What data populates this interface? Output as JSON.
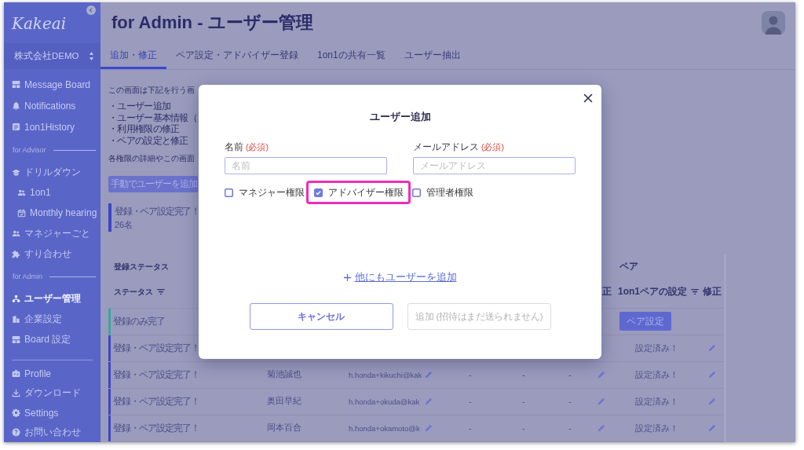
{
  "sidebar": {
    "logo": "Kakeai",
    "company": "株式会社DEMO",
    "sections": [
      {
        "items": [
          {
            "label": "Message Board",
            "selected": false
          },
          {
            "label": "Notifications",
            "selected": false
          },
          {
            "label": "1on1History",
            "selected": false
          }
        ]
      },
      {
        "heading": "for Advisor",
        "items": [
          {
            "label": "ドリルダウン",
            "selected": false,
            "children": [
              {
                "label": "1on1",
                "selected": false
              },
              {
                "label": "Monthly hearing",
                "selected": false
              }
            ]
          },
          {
            "label": "マネジャーごと",
            "selected": false
          },
          {
            "label": "すり合わせ",
            "selected": false
          }
        ]
      },
      {
        "heading": "for Admin",
        "items": [
          {
            "label": "ユーザー管理",
            "selected": true
          },
          {
            "label": "企業設定",
            "selected": false
          },
          {
            "label": "Board 設定",
            "selected": false
          }
        ]
      },
      {
        "items": [
          {
            "label": "Profile",
            "selected": false
          },
          {
            "label": "ダウンロード",
            "selected": false
          },
          {
            "label": "Settings",
            "selected": false
          },
          {
            "label": "お問い合わせ",
            "selected": false
          }
        ]
      }
    ]
  },
  "header": {
    "title": "for Admin - ユーザー管理",
    "tabs": [
      {
        "label": "追加・修正",
        "selected": true
      },
      {
        "label": "ペア設定・アドバイザー登録",
        "selected": false
      },
      {
        "label": "1on1の共有一覧",
        "selected": false
      },
      {
        "label": "ユーザー抽出",
        "selected": false
      }
    ]
  },
  "intro": {
    "lead": "この画面は下記を行う画",
    "bullets": [
      "・ユーザー追加",
      "・ユーザー基本情報（",
      "・利用権限の修正",
      "・ペアの設定と修正"
    ],
    "note": "各権限の詳細やこの画面",
    "button": "手動でユーザーを追加"
  },
  "summary": {
    "title": "登録・ペア設定完了！",
    "count": "26名"
  },
  "table": {
    "groups": [
      {
        "label": "登録ステータス"
      },
      {
        "label": "ペア"
      }
    ],
    "columns": [
      {
        "label": "ステータス",
        "filter": true
      },
      {
        "label": "正",
        "filter": false
      },
      {
        "label": "1on1ペアの設定",
        "filter": true
      },
      {
        "label": "修正",
        "filter": false
      }
    ],
    "rows": [
      {
        "status": "登録のみ完了",
        "color": "#3aa89b",
        "pair": {
          "kind": "button",
          "label": "ペア設定"
        }
      },
      {
        "status": "登録・ペア設定完了！",
        "color": "#3d47c8",
        "pair": {
          "kind": "text",
          "label": "設定済み！"
        }
      },
      {
        "status": "登録・ペア設定完了！",
        "color": "#3d47c8",
        "name": "菊池誠也",
        "email": "h.honda+kikuchi@kak",
        "values": [
          "-",
          "-",
          "-"
        ],
        "pair": {
          "kind": "text",
          "label": "設定済み！"
        }
      },
      {
        "status": "登録・ペア設定完了！",
        "color": "#3d47c8",
        "name": "奥田早紀",
        "email": "h.honda+okuda@kak",
        "values": [
          "-",
          "-",
          "-"
        ],
        "pair": {
          "kind": "text",
          "label": "設定済み！"
        }
      },
      {
        "status": "登録・ペア設定完了！",
        "color": "#3d47c8",
        "name": "岡本百合",
        "email": "h.honda+okamoto@k",
        "values": [
          "-",
          "-",
          "-"
        ],
        "pair": {
          "kind": "text",
          "label": "設定済み！"
        }
      }
    ]
  },
  "dialog": {
    "title": "ユーザー追加",
    "fields": [
      {
        "label": "名前",
        "required": "(必須)",
        "placeholder": "名前"
      },
      {
        "label": "メールアドレス",
        "required": "(必須)",
        "placeholder": "メールアドレス"
      }
    ],
    "permissions": [
      {
        "label": "マネジャー権限",
        "checked": false,
        "highlighted": false
      },
      {
        "label": "アドバイザー権限",
        "checked": true,
        "highlighted": true
      },
      {
        "label": "管理者権限",
        "checked": false,
        "highlighted": false
      }
    ],
    "add_more": "他にもユーザーを追加",
    "buttons": [
      {
        "label": "キャンセル",
        "disabled": false
      },
      {
        "label": "追加",
        "note": "(招待はまだ送られません)",
        "disabled": true
      }
    ]
  }
}
